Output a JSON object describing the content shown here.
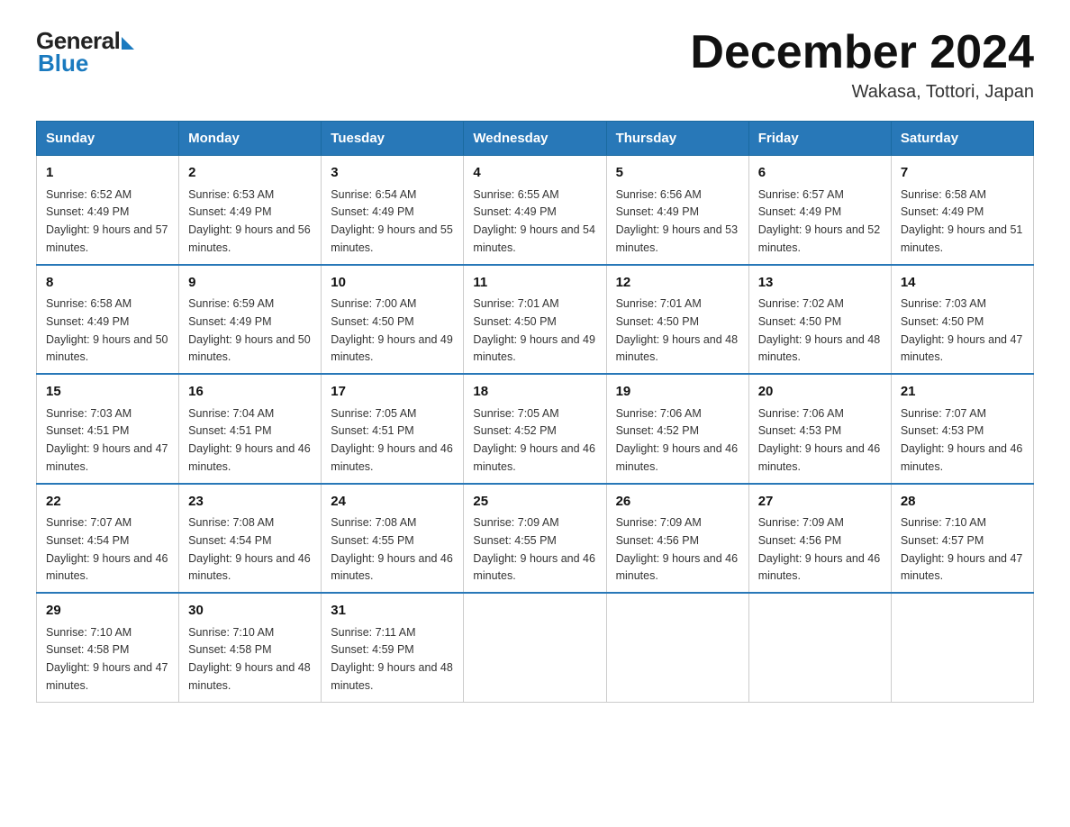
{
  "logo": {
    "general": "General",
    "blue": "Blue",
    "subtitle": "Blue"
  },
  "title": "December 2024",
  "location": "Wakasa, Tottori, Japan",
  "headers": [
    "Sunday",
    "Monday",
    "Tuesday",
    "Wednesday",
    "Thursday",
    "Friday",
    "Saturday"
  ],
  "weeks": [
    [
      {
        "day": "1",
        "sunrise": "6:52 AM",
        "sunset": "4:49 PM",
        "daylight": "9 hours and 57 minutes."
      },
      {
        "day": "2",
        "sunrise": "6:53 AM",
        "sunset": "4:49 PM",
        "daylight": "9 hours and 56 minutes."
      },
      {
        "day": "3",
        "sunrise": "6:54 AM",
        "sunset": "4:49 PM",
        "daylight": "9 hours and 55 minutes."
      },
      {
        "day": "4",
        "sunrise": "6:55 AM",
        "sunset": "4:49 PM",
        "daylight": "9 hours and 54 minutes."
      },
      {
        "day": "5",
        "sunrise": "6:56 AM",
        "sunset": "4:49 PM",
        "daylight": "9 hours and 53 minutes."
      },
      {
        "day": "6",
        "sunrise": "6:57 AM",
        "sunset": "4:49 PM",
        "daylight": "9 hours and 52 minutes."
      },
      {
        "day": "7",
        "sunrise": "6:58 AM",
        "sunset": "4:49 PM",
        "daylight": "9 hours and 51 minutes."
      }
    ],
    [
      {
        "day": "8",
        "sunrise": "6:58 AM",
        "sunset": "4:49 PM",
        "daylight": "9 hours and 50 minutes."
      },
      {
        "day": "9",
        "sunrise": "6:59 AM",
        "sunset": "4:49 PM",
        "daylight": "9 hours and 50 minutes."
      },
      {
        "day": "10",
        "sunrise": "7:00 AM",
        "sunset": "4:50 PM",
        "daylight": "9 hours and 49 minutes."
      },
      {
        "day": "11",
        "sunrise": "7:01 AM",
        "sunset": "4:50 PM",
        "daylight": "9 hours and 49 minutes."
      },
      {
        "day": "12",
        "sunrise": "7:01 AM",
        "sunset": "4:50 PM",
        "daylight": "9 hours and 48 minutes."
      },
      {
        "day": "13",
        "sunrise": "7:02 AM",
        "sunset": "4:50 PM",
        "daylight": "9 hours and 48 minutes."
      },
      {
        "day": "14",
        "sunrise": "7:03 AM",
        "sunset": "4:50 PM",
        "daylight": "9 hours and 47 minutes."
      }
    ],
    [
      {
        "day": "15",
        "sunrise": "7:03 AM",
        "sunset": "4:51 PM",
        "daylight": "9 hours and 47 minutes."
      },
      {
        "day": "16",
        "sunrise": "7:04 AM",
        "sunset": "4:51 PM",
        "daylight": "9 hours and 46 minutes."
      },
      {
        "day": "17",
        "sunrise": "7:05 AM",
        "sunset": "4:51 PM",
        "daylight": "9 hours and 46 minutes."
      },
      {
        "day": "18",
        "sunrise": "7:05 AM",
        "sunset": "4:52 PM",
        "daylight": "9 hours and 46 minutes."
      },
      {
        "day": "19",
        "sunrise": "7:06 AM",
        "sunset": "4:52 PM",
        "daylight": "9 hours and 46 minutes."
      },
      {
        "day": "20",
        "sunrise": "7:06 AM",
        "sunset": "4:53 PM",
        "daylight": "9 hours and 46 minutes."
      },
      {
        "day": "21",
        "sunrise": "7:07 AM",
        "sunset": "4:53 PM",
        "daylight": "9 hours and 46 minutes."
      }
    ],
    [
      {
        "day": "22",
        "sunrise": "7:07 AM",
        "sunset": "4:54 PM",
        "daylight": "9 hours and 46 minutes."
      },
      {
        "day": "23",
        "sunrise": "7:08 AM",
        "sunset": "4:54 PM",
        "daylight": "9 hours and 46 minutes."
      },
      {
        "day": "24",
        "sunrise": "7:08 AM",
        "sunset": "4:55 PM",
        "daylight": "9 hours and 46 minutes."
      },
      {
        "day": "25",
        "sunrise": "7:09 AM",
        "sunset": "4:55 PM",
        "daylight": "9 hours and 46 minutes."
      },
      {
        "day": "26",
        "sunrise": "7:09 AM",
        "sunset": "4:56 PM",
        "daylight": "9 hours and 46 minutes."
      },
      {
        "day": "27",
        "sunrise": "7:09 AM",
        "sunset": "4:56 PM",
        "daylight": "9 hours and 46 minutes."
      },
      {
        "day": "28",
        "sunrise": "7:10 AM",
        "sunset": "4:57 PM",
        "daylight": "9 hours and 47 minutes."
      }
    ],
    [
      {
        "day": "29",
        "sunrise": "7:10 AM",
        "sunset": "4:58 PM",
        "daylight": "9 hours and 47 minutes."
      },
      {
        "day": "30",
        "sunrise": "7:10 AM",
        "sunset": "4:58 PM",
        "daylight": "9 hours and 48 minutes."
      },
      {
        "day": "31",
        "sunrise": "7:11 AM",
        "sunset": "4:59 PM",
        "daylight": "9 hours and 48 minutes."
      },
      null,
      null,
      null,
      null
    ]
  ]
}
